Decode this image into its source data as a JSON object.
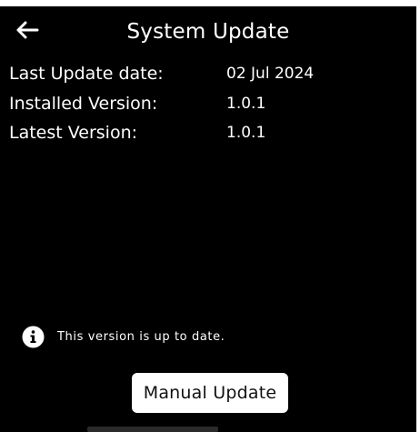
{
  "header": {
    "back_icon": "arrow-left-icon",
    "title": "System Update"
  },
  "info": {
    "rows": [
      {
        "label": "Last Update date:",
        "value": "02 Jul 2024"
      },
      {
        "label": "Installed Version:",
        "value": "1.0.1"
      },
      {
        "label": "Latest Version:",
        "value": "1.0.1"
      }
    ]
  },
  "status": {
    "icon": "info-icon",
    "text": "This version is up to date."
  },
  "actions": {
    "manual_update_label": "Manual Update"
  },
  "colors": {
    "background": "#000000",
    "text": "#ffffff",
    "button_bg": "#ffffff",
    "button_text": "#111111"
  }
}
